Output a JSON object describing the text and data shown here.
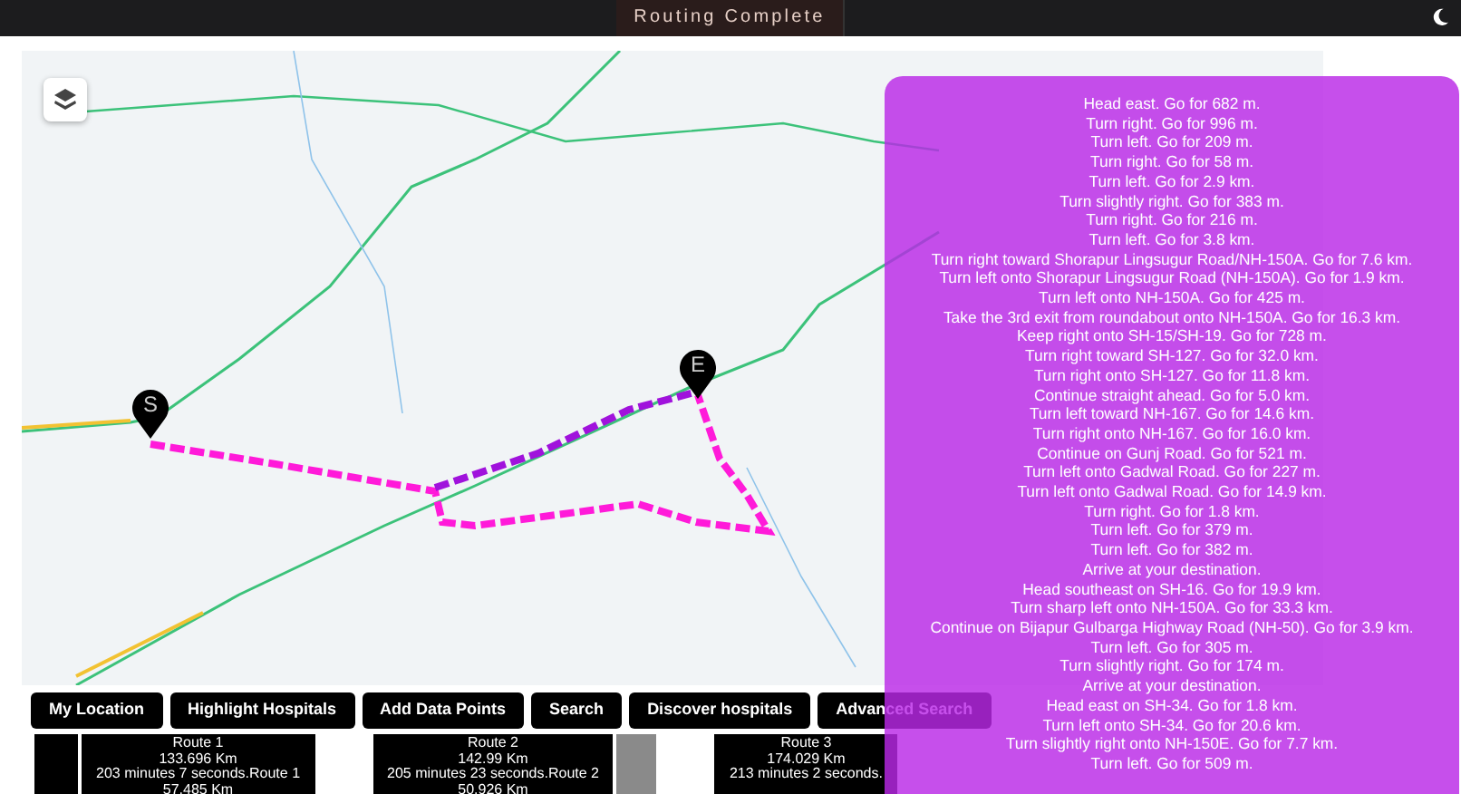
{
  "header": {
    "title": "Routing Complete"
  },
  "map": {
    "markers": [
      {
        "label": "S"
      },
      {
        "label": "E"
      }
    ],
    "routes": [
      {
        "color": "#ff1ad9"
      },
      {
        "color": "#a012dc"
      }
    ]
  },
  "buttons": [
    "My Location",
    "Highlight Hospitals",
    "Add Data Points",
    "Search",
    "Discover hospitals",
    "Advanced Search"
  ],
  "route_strip": [
    {
      "kind": "dark"
    },
    {
      "kind": "route",
      "lines": [
        "Route 1",
        "133.696 Km",
        "203 minutes 7 seconds.Route 1",
        "57.485 Km"
      ]
    },
    {
      "kind": "gap"
    },
    {
      "kind": "route",
      "lines": [
        "Route 2",
        "142.99 Km",
        "205 minutes 23 seconds.Route 2",
        "50.926 Km"
      ]
    },
    {
      "kind": "grey"
    },
    {
      "kind": "gap"
    },
    {
      "kind": "route",
      "lines": [
        "Route 3",
        "174.029 Km",
        "213 minutes 2 seconds."
      ]
    }
  ],
  "directions": [
    "Head east. Go for 682 m.",
    "Turn right. Go for 996 m.",
    "Turn left. Go for 209 m.",
    "Turn right. Go for 58 m.",
    "Turn left. Go for 2.9 km.",
    "Turn slightly right. Go for 383 m.",
    "Turn right. Go for 216 m.",
    "Turn left. Go for 3.8 km.",
    "Turn right toward Shorapur Lingsugur Road/NH-150A. Go for 7.6 km.",
    "Turn left onto Shorapur Lingsugur Road (NH-150A). Go for 1.9 km.",
    "Turn left onto NH-150A. Go for 425 m.",
    "Take the 3rd exit from roundabout onto NH-150A. Go for 16.3 km.",
    "Keep right onto SH-15/SH-19. Go for 728 m.",
    "Turn right toward SH-127. Go for 32.0 km.",
    "Turn right onto SH-127. Go for 11.8 km.",
    "Continue straight ahead. Go for 5.0 km.",
    "Turn left toward NH-167. Go for 14.6 km.",
    "Turn right onto NH-167. Go for 16.0 km.",
    "Continue on Gunj Road. Go for 521 m.",
    "Turn left onto Gadwal Road. Go for 227 m.",
    "Turn left onto Gadwal Road. Go for 14.9 km.",
    "Turn right. Go for 1.8 km.",
    "Turn left. Go for 379 m.",
    "Turn left. Go for 382 m.",
    "Arrive at your destination.",
    "Head southeast on SH-16. Go for 19.9 km.",
    "Turn sharp left onto NH-150A. Go for 33.3 km.",
    "Continue on Bijapur Gulbarga Highway Road (NH-50). Go for 3.9 km.",
    "Turn left. Go for 305 m.",
    "Turn slightly right. Go for 174 m.",
    "Arrive at your destination.",
    "Head east on SH-34. Go for 1.8 km.",
    "Turn left onto SH-34. Go for 20.6 km.",
    "Turn slightly right onto NH-150E. Go for 7.7 km.",
    "Turn left. Go for 509 m."
  ]
}
